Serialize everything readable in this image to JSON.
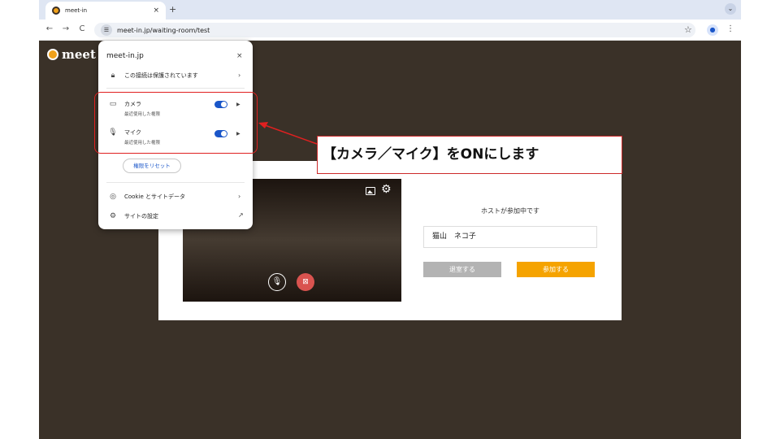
{
  "browser": {
    "tab_title": "meet-in",
    "tab_close": "×",
    "new_tab": "+",
    "url": "meet-in.jp/waiting-room/test",
    "back": "←",
    "forward": "→",
    "reload": "C",
    "star": "☆",
    "menu": "⋮"
  },
  "page": {
    "brand": "meet i",
    "host_status": "ホストが参加中です",
    "name_value": "猫山　ネコ子",
    "leave_label": "退室する",
    "join_label": "参加する"
  },
  "popup": {
    "domain": "meet-in.jp",
    "close": "×",
    "connection": "この接続は保護されています",
    "camera_label": "カメラ",
    "camera_sub": "最近使用した権限",
    "mic_label": "マイク",
    "mic_sub": "最近使用した権限",
    "reset_label": "権限をリセット",
    "cookie_label": "Cookie とサイトデータ",
    "site_settings_label": "サイトの設定"
  },
  "permissions": {
    "camera_on": true,
    "mic_on": true
  },
  "annotation": {
    "callout": "【カメラ／マイク】をONにします",
    "color": "#e02020"
  },
  "colors": {
    "page_bg": "#3a3128",
    "accent_orange": "#f5a300",
    "toggle_blue": "#1a56c9",
    "leave_gray": "#b3b3b3"
  }
}
